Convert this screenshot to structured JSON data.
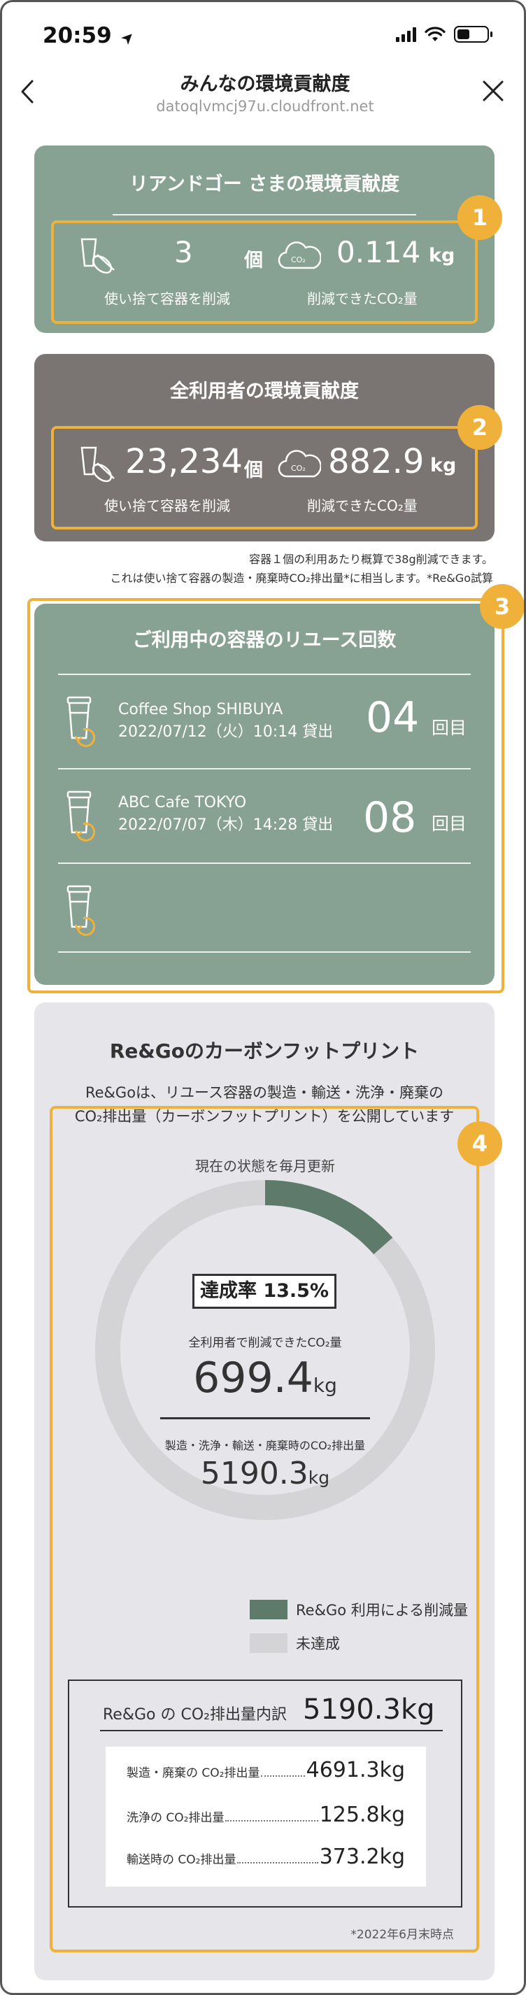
{
  "status_bar": {
    "time": "20:59",
    "location_arrow": "➤"
  },
  "header": {
    "title": "みんなの環境貢献度",
    "url": "datoqlvmcj97u.cloudfront.net",
    "back_icon": "chevron-left",
    "close_icon": "close"
  },
  "personal": {
    "title": "リアンドゴー さまの環境貢献度",
    "badge": "1",
    "containers_value": "3",
    "containers_unit": "個",
    "containers_label": "使い捨て容器を削減",
    "co2_value": "0.114",
    "co2_unit": "kg",
    "co2_label": "削減できたCO₂量"
  },
  "all_users": {
    "title": "全利用者の環境貢献度",
    "badge": "2",
    "containers_value": "23,234",
    "containers_unit": "個",
    "containers_label": "使い捨て容器を削減",
    "co2_value": "882.9",
    "co2_unit": "kg",
    "co2_label": "削減できたCO₂量"
  },
  "notes": {
    "line1": "容器１個の利用あたり概算で38g削減できます。",
    "line2": "これは使い捨て容器の製造・廃棄時CO₂排出量*に相当します。*Re&Go試算"
  },
  "reuse": {
    "title": "ご利用中の容器のリユース回数",
    "badge": "3",
    "rows": [
      {
        "shop": "Coffee Shop SHIBUYA",
        "date": "2022/07/12（火）10:14 貸出",
        "count": "04",
        "unit": "回目"
      },
      {
        "shop": "ABC Cafe TOKYO",
        "date": "2022/07/07（木）14:28 貸出",
        "count": "08",
        "unit": "回目"
      },
      {
        "shop": "",
        "date": "",
        "count": "",
        "unit": ""
      }
    ]
  },
  "carbon": {
    "title": "Re&Goのカーボンフットプリント",
    "desc_line1": "Re&Goは、リユース容器の製造・輸送・洗浄・廃棄の",
    "desc_line2": "CO₂排出量（カーボンフットプリント）を公開しています",
    "badge": "4",
    "update_note": "現在の状態を毎月更新",
    "achievement_label": "達成率 13.5%",
    "achievement_rate": 0.135,
    "reduced_label": "全利用者で削減できたCO₂量",
    "reduced_value": "699.4",
    "reduced_unit": "kg",
    "emission_label": "製造・洗浄・輸送・廃棄時のCO₂排出量",
    "emission_value": "5190.3",
    "emission_unit": "kg",
    "legend": [
      {
        "label": "Re&Go 利用による削減量",
        "color": "#5e7a6b"
      },
      {
        "label": "未達成",
        "color": "#d4d4d6"
      }
    ],
    "breakdown_title": "Re&Go の CO₂排出量内訳",
    "breakdown_total": "5190.3kg",
    "breakdown_rows": [
      {
        "label": "製造・廃棄の CO₂排出量",
        "value": "4691.3kg"
      },
      {
        "label": "洗浄の CO₂排出量",
        "value": "125.8kg"
      },
      {
        "label": "輸送時の CO₂排出量",
        "value": "373.2kg"
      }
    ],
    "footnote": "*2022年6月末時点"
  }
}
